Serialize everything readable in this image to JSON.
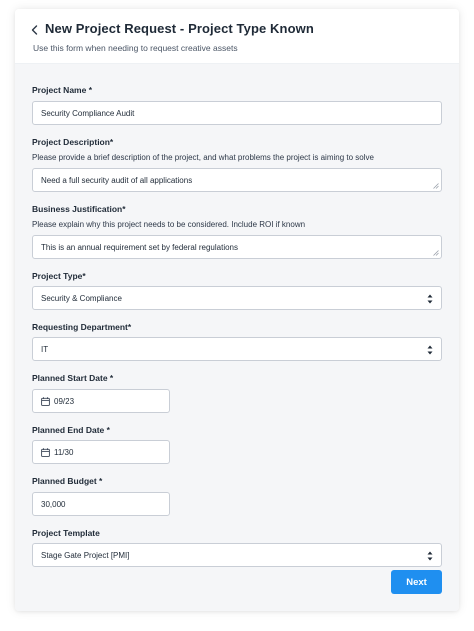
{
  "header": {
    "title": "New Project Request - Project Type Known",
    "subtitle": "Use this form when needing to request creative assets",
    "back_icon": "chevron-left-icon"
  },
  "form": {
    "project_name": {
      "label": "Project Name *",
      "value": "Security Compliance Audit"
    },
    "project_description": {
      "label": "Project Description*",
      "help": "Please provide a brief description of the project, and what problems the project is aiming to solve",
      "value": "Need a full security audit of all applications"
    },
    "business_justification": {
      "label": "Business Justification*",
      "help": "Please explain why this project needs to be considered. Include ROI if known",
      "value": "This is an annual requirement set by federal regulations"
    },
    "project_type": {
      "label": "Project Type*",
      "value": "Security & Compliance"
    },
    "requesting_department": {
      "label": "Requesting Department*",
      "value": "IT"
    },
    "planned_start_date": {
      "label": "Planned Start Date *",
      "value": "09/23",
      "icon": "calendar-icon"
    },
    "planned_end_date": {
      "label": "Planned End Date *",
      "value": "11/30",
      "icon": "calendar-icon"
    },
    "planned_budget": {
      "label": "Planned Budget *",
      "value": "30,000"
    },
    "project_template": {
      "label": "Project Template",
      "value": "Stage Gate Project [PMI]"
    }
  },
  "actions": {
    "next_label": "Next"
  },
  "colors": {
    "accent": "#1f8ff0",
    "body_bg": "#f5f6f8",
    "border": "#c9ced6"
  }
}
